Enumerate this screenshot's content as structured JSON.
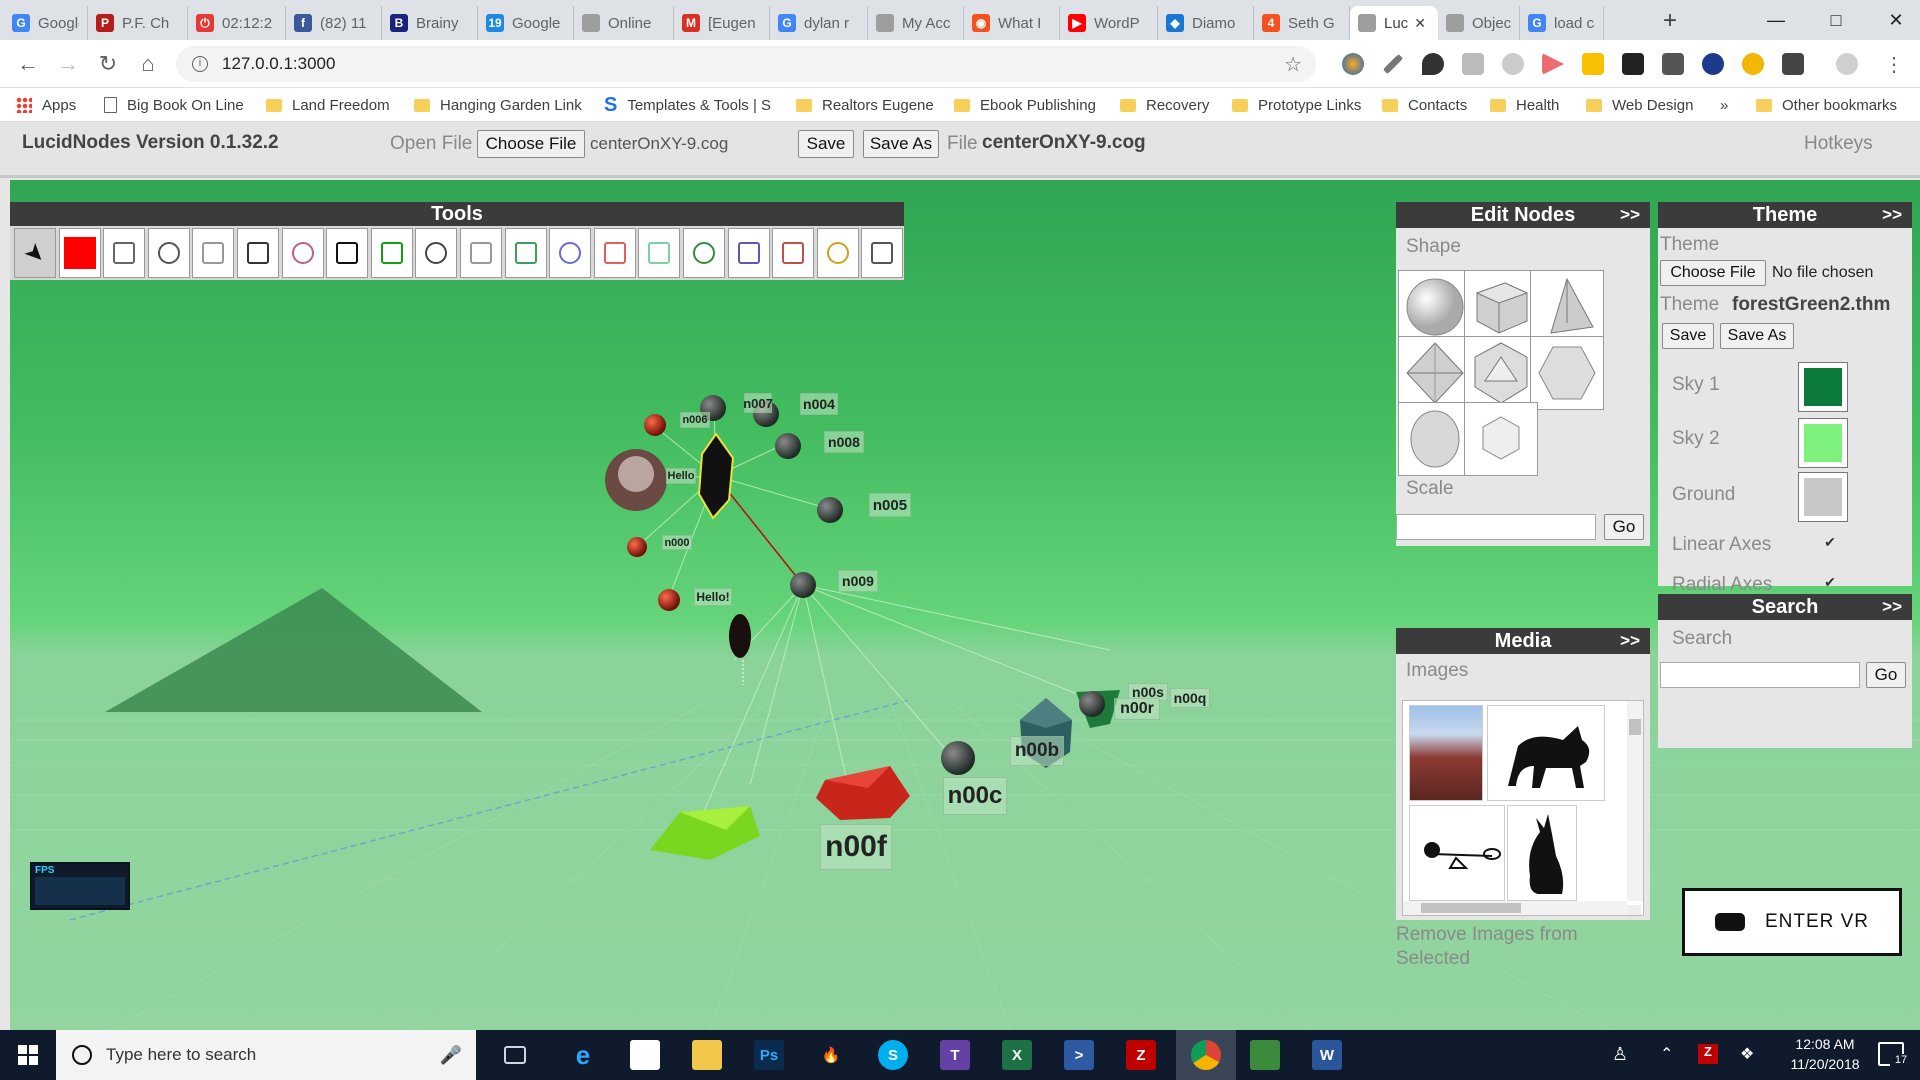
{
  "browser": {
    "tabs": [
      {
        "label": "Google",
        "color": "#4285f4",
        "glyph": "G"
      },
      {
        "label": "P.F. Ch",
        "color": "#b71c1c",
        "glyph": "P"
      },
      {
        "label": "02:12:2",
        "color": "#e53935",
        "glyph": "⏻"
      },
      {
        "label": "(82) 11",
        "color": "#3b5998",
        "glyph": "f"
      },
      {
        "label": "Brainy",
        "color": "#1a237e",
        "glyph": "B"
      },
      {
        "label": "Google",
        "color": "#1e88e5",
        "glyph": "19"
      },
      {
        "label": "Online",
        "color": "#9e9e9e",
        "glyph": ""
      },
      {
        "label": "[Eugen",
        "color": "#d93025",
        "glyph": "M"
      },
      {
        "label": "dylan r",
        "color": "#4285f4",
        "glyph": "G"
      },
      {
        "label": "My Acc",
        "color": "#9e9e9e",
        "glyph": ""
      },
      {
        "label": "What I",
        "color": "#f4511e",
        "glyph": "◉"
      },
      {
        "label": "WordP",
        "color": "#ff0000",
        "glyph": "▶"
      },
      {
        "label": "Diamo",
        "color": "#1976d2",
        "glyph": "◆"
      },
      {
        "label": "Seth G",
        "color": "#f4511e",
        "glyph": "4"
      },
      {
        "label": "Luc",
        "color": "#9e9e9e",
        "glyph": "",
        "active": true
      },
      {
        "label": "Object",
        "color": "#9e9e9e",
        "glyph": ""
      },
      {
        "label": "load ca",
        "color": "#4285f4",
        "glyph": "G"
      }
    ],
    "new_tab": "+",
    "url": "127.0.0.1:3000",
    "bookmarks": [
      {
        "label": "Apps",
        "type": "apps"
      },
      {
        "label": "Big Book On Line",
        "type": "page"
      },
      {
        "label": "Land Freedom",
        "type": "folder"
      },
      {
        "label": "Hanging Garden Link",
        "type": "folder"
      },
      {
        "label": "Templates & Tools | S",
        "type": "s"
      },
      {
        "label": "Realtors Eugene",
        "type": "folder"
      },
      {
        "label": "Ebook Publishing",
        "type": "folder"
      },
      {
        "label": "Recovery",
        "type": "folder"
      },
      {
        "label": "Prototype Links",
        "type": "folder"
      },
      {
        "label": "Contacts",
        "type": "folder"
      },
      {
        "label": "Health",
        "type": "folder"
      },
      {
        "label": "Web Design",
        "type": "folder"
      }
    ],
    "bookmarks_more": "»",
    "other_bookmarks": "Other bookmarks"
  },
  "app": {
    "version": "LucidNodes Version 0.1.32.2",
    "open_file_label": "Open File",
    "choose_file": "Choose File",
    "file_value": "centerOnXY-9.cog",
    "save": "Save",
    "save_as": "Save As",
    "file_label": "File",
    "file_name": "centerOnXY-9.cog",
    "hotkeys": "Hotkeys"
  },
  "tools": {
    "title": "Tools",
    "items": [
      "select-arrow",
      "color-red",
      "paint",
      "eyedropper",
      "move",
      "rotate",
      "network",
      "center-node",
      "add-node",
      "connect",
      "delete",
      "tool-12",
      "tool-13",
      "tool-14",
      "cube",
      "tool-16",
      "tool-17",
      "tool-18",
      "tool-19",
      "tool-20"
    ]
  },
  "edit_nodes": {
    "title": "Edit Nodes",
    "more": ">>",
    "shape_label": "Shape",
    "shapes": [
      "sphere",
      "cube",
      "pyramid",
      "octahedron",
      "icosahedron",
      "hexagon",
      "circle",
      "hexagon-flat"
    ],
    "scale_label": "Scale",
    "scale_value": "",
    "go": "Go"
  },
  "media": {
    "title": "Media",
    "more": ">>",
    "images_label": "Images",
    "remove_label": "Remove Images from Selected"
  },
  "theme": {
    "title": "Theme",
    "more": ">>",
    "theme_label": "Theme",
    "choose_file": "Choose File",
    "no_file": "No file chosen",
    "theme_name_label": "Theme",
    "theme_name": "forestGreen2.thm",
    "save": "Save",
    "save_as": "Save As",
    "sky1_label": "Sky 1",
    "sky1_color": "#0b7a3a",
    "sky2_label": "Sky 2",
    "sky2_color": "#7ef07e",
    "ground_label": "Ground",
    "ground_color": "#c8c8c8",
    "linear_axes": "Linear Axes",
    "radial_axes": "Radial Axes",
    "check": "✔"
  },
  "search": {
    "title": "Search",
    "more": ">>",
    "label": "Search",
    "value": "",
    "go": "Go"
  },
  "scene": {
    "fps_label": "FPS",
    "enter_vr": "ENTER VR",
    "labels": {
      "n007": "n007",
      "n004": "n004",
      "n006": "n006",
      "n008": "n008",
      "hello1": "Hello",
      "n005": "n005",
      "n000": "n000",
      "n009": "n009",
      "hello2": "Hello!",
      "n00s": "n00s",
      "n00r": "n00r",
      "n00q": "n00q",
      "n00b": "n00b",
      "n00c": "n00c",
      "n00f": "n00f"
    }
  },
  "taskbar": {
    "search_placeholder": "Type here to search",
    "time": "12:08 AM",
    "date": "11/20/2018",
    "notifications": "17"
  }
}
